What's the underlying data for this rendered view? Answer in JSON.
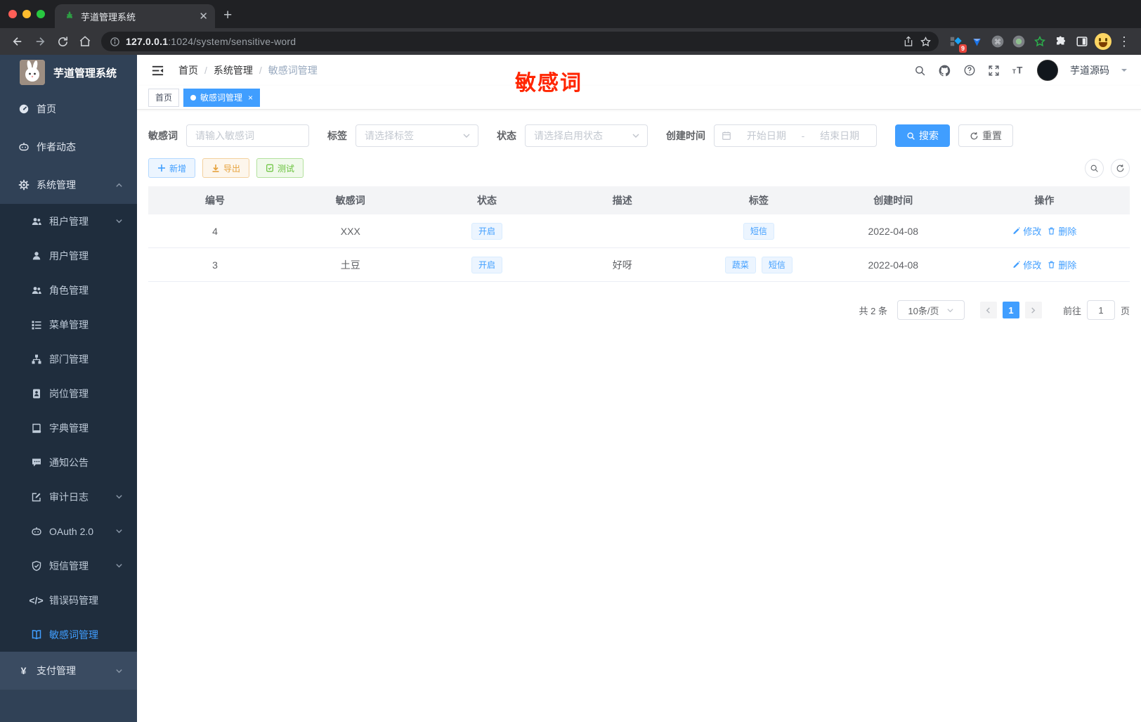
{
  "colors": {
    "accent": "#409eff",
    "warning": "#e6a23c",
    "success": "#67c23a",
    "annotation": "#ff2500",
    "sidebar-bg": "#304156",
    "submenu-bg": "#1f2d3d"
  },
  "browser": {
    "tab_title": "芋道管理系统",
    "url_host": "127.0.0.1",
    "url_path": ":1024/system/sensitive-word",
    "extension_badge": "9"
  },
  "sidebar": {
    "app_title": "芋道管理系统",
    "menu": [
      {
        "label": "首页"
      },
      {
        "label": "作者动态"
      },
      {
        "label": "系统管理"
      },
      {
        "label": "租户管理"
      },
      {
        "label": "用户管理"
      },
      {
        "label": "角色管理"
      },
      {
        "label": "菜单管理"
      },
      {
        "label": "部门管理"
      },
      {
        "label": "岗位管理"
      },
      {
        "label": "字典管理"
      },
      {
        "label": "通知公告"
      },
      {
        "label": "审计日志"
      },
      {
        "label": "OAuth 2.0"
      },
      {
        "label": "短信管理"
      },
      {
        "label": "错误码管理"
      },
      {
        "label": "敏感词管理"
      },
      {
        "label": "支付管理"
      }
    ]
  },
  "header": {
    "breadcrumb": [
      "首页",
      "系统管理",
      "敏感词管理"
    ],
    "annotation": "敏感词",
    "username": "芋道源码"
  },
  "tabsbar": {
    "tabs": [
      {
        "label": "首页"
      },
      {
        "label": "敏感词管理"
      }
    ]
  },
  "filters": {
    "keyword_label": "敏感词",
    "keyword_placeholder": "请输入敏感词",
    "tag_label": "标签",
    "tag_placeholder": "请选择标签",
    "status_label": "状态",
    "status_placeholder": "请选择启用状态",
    "date_label": "创建时间",
    "date_start": "开始日期",
    "date_separator": "-",
    "date_end": "结束日期",
    "search_label": "搜索",
    "reset_label": "重置"
  },
  "toolbar": {
    "add_label": "新增",
    "export_label": "导出",
    "test_label": "测试"
  },
  "table": {
    "columns": [
      "编号",
      "敏感词",
      "状态",
      "描述",
      "标签",
      "创建时间",
      "操作"
    ],
    "rows": [
      {
        "id": "4",
        "word": "XXX",
        "status": "开启",
        "description": "",
        "tags": [
          "短信"
        ],
        "created": "2022-04-08",
        "edit_label": "修改",
        "delete_label": "删除"
      },
      {
        "id": "3",
        "word": "土豆",
        "status": "开启",
        "description": "好呀",
        "tags": [
          "蔬菜",
          "短信"
        ],
        "created": "2022-04-08",
        "edit_label": "修改",
        "delete_label": "删除"
      }
    ]
  },
  "pagination": {
    "total": "共 2 条",
    "page_size": "10条/页",
    "current_page": "1",
    "goto_label": "前往",
    "goto_value": "1",
    "page_unit": "页"
  }
}
